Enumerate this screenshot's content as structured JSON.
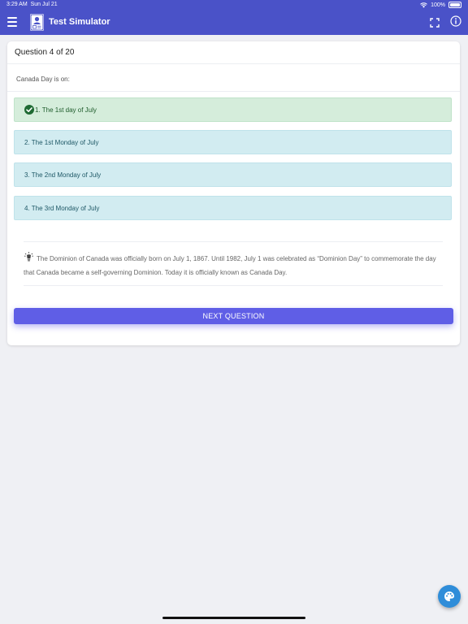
{
  "status_bar": {
    "time": "3:29 AM",
    "date": "Sun Jul 21",
    "battery_pct": "100%"
  },
  "header": {
    "title": "Test Simulator",
    "icons": [
      "menu-icon",
      "logo-icon",
      "fullscreen-icon",
      "info-icon"
    ]
  },
  "question": {
    "counter": "Question 4 of 20",
    "prompt": "Canada Day is on:",
    "options": [
      {
        "label": "1. The 1st day of July",
        "state": "correct"
      },
      {
        "label": "2. The 1st Monday of July",
        "state": "neutral"
      },
      {
        "label": "3. The 2nd Monday of July",
        "state": "neutral"
      },
      {
        "label": "4. The 3rd Monday of July",
        "state": "neutral"
      }
    ],
    "explanation": "The Dominion of Canada was officially born on July 1, 1867. Until 1982, July 1 was celebrated as “Dominion Day” to commemorate the day that Canada became a self-governing Dominion. Today it is officially known as Canada Day."
  },
  "next_button": {
    "label": "NEXT QUESTION"
  },
  "colors": {
    "header_bg": "#4a52c8",
    "correct_bg": "#d5eddb",
    "option_bg": "#d2ecf1",
    "next_button_bg": "#5f5ee6",
    "fab_bg": "#2f8dd9"
  }
}
